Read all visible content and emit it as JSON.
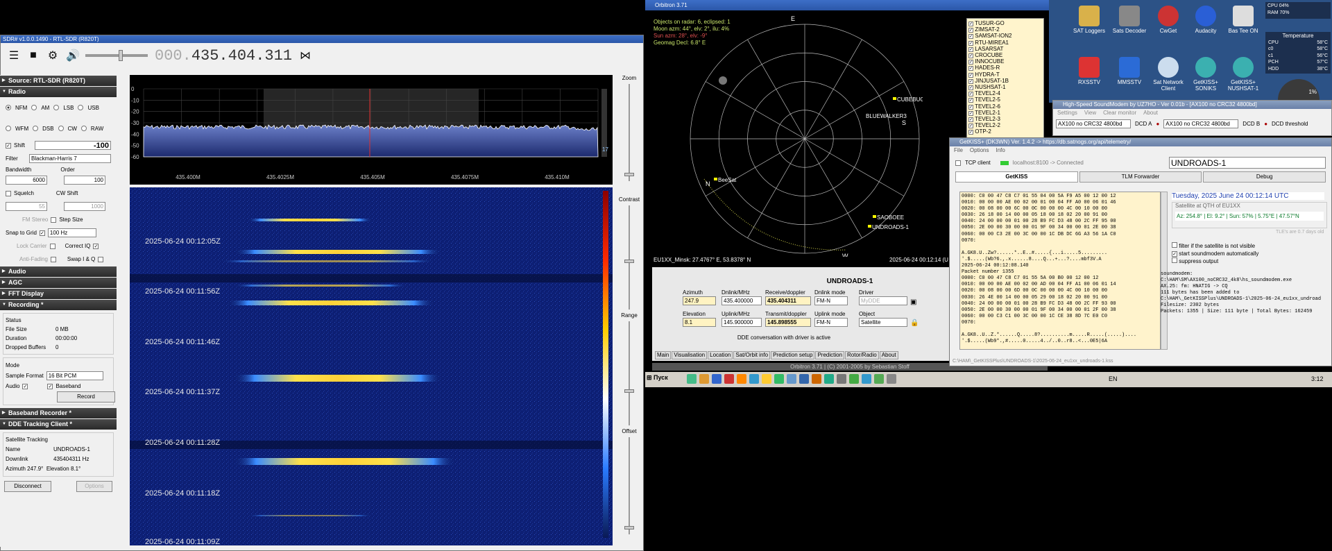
{
  "sdr": {
    "title": "SDR# v1.0.0.1490 - RTL-SDR (R820T)",
    "freq_dim": "000.",
    "freq_main": "435.404.311",
    "sections": {
      "source": "Source: RTL-SDR (R820T)",
      "radio": "Radio",
      "audio": "Audio",
      "agc": "AGC",
      "fft": "FFT Display",
      "recording": "Recording *",
      "baseband": "Baseband Recorder *",
      "dde": "DDE Tracking Client *"
    },
    "modes": [
      "NFM",
      "AM",
      "LSB",
      "USB",
      "WFM",
      "DSB",
      "CW",
      "RAW"
    ],
    "shift_label": "Shift",
    "shift_value": "-100",
    "filter_label": "Filter",
    "filter_value": "Blackman-Harris 7",
    "bandwidth_label": "Bandwidth",
    "bandwidth_value": "6000",
    "order_label": "Order",
    "order_value": "100",
    "squelch": "Squelch",
    "cw_shift": "CW Shift",
    "sq_value": "55",
    "cw_value": "1000",
    "fm_stereo": "FM Stereo",
    "step_size": "Step Size",
    "snap": "Snap to Grid",
    "snap_value": "100 Hz",
    "lock_carrier": "Lock Carrier",
    "correct_iq": "Correct IQ",
    "anti_fading": "Anti-Fading",
    "swap_iq": "Swap I & Q",
    "status": "Status",
    "file_size_l": "File Size",
    "file_size": "0 MB",
    "duration_l": "Duration",
    "duration": "00:00:00",
    "dropped_l": "Dropped Buffers",
    "dropped": "0",
    "mode_l": "Mode",
    "sample_format_l": "Sample Format",
    "sample_format": "16 Bit PCM",
    "audio_chk": "Audio",
    "baseband_chk": "Baseband",
    "record_btn": "Record",
    "sat_tracking": "Satellite Tracking",
    "name_l": "Name",
    "name": "UNDROADS-1",
    "downlink_l": "Downlink",
    "downlink": "435404311 Hz",
    "azimuth_l": "Azimuth",
    "azimuth": "247.9°",
    "elevation_l": "Elevation",
    "elevation": "8.1°",
    "disconnect": "Disconnect",
    "options": "Options",
    "zoom": "Zoom",
    "contrast": "Contrast",
    "range": "Range",
    "offset": "Offset",
    "spectrum_y": [
      "0",
      "-10",
      "-20",
      "-30",
      "-40",
      "-50",
      "-60"
    ],
    "spectrum_x": [
      "435.400M",
      "435.4025M",
      "435.405M",
      "435.4075M",
      "435.410M"
    ],
    "spectrum_side": "17",
    "wf_times": [
      "2025-06-24 00:12:05Z",
      "2025-06-24 00:11:56Z",
      "2025-06-24 00:11:46Z",
      "2025-06-24 00:11:37Z",
      "2025-06-24 00:11:28Z",
      "2025-06-24 00:11:18Z",
      "2025-06-24 00:11:09Z"
    ]
  },
  "orbitron": {
    "title": "Orbitron 3.71",
    "info": [
      "Objects on radar: 6, eclipsed: 1",
      "Moon azm: 44°, elv: 2°, ilu: 4%",
      "Sun azm: 28°, elv: -9°",
      "",
      "Geomag Decl: 6.8° E"
    ],
    "compass": {
      "n": "N",
      "e": "E",
      "s": "S",
      "w": "W"
    },
    "radar_labels": [
      "CUBEBUG-2",
      "BLUEWALKER3",
      "BeeSat",
      "SAOBOEE",
      "UNDROADS-1"
    ],
    "location": "EU1XX_Minsk: 27.4767° E, 53.8378° N",
    "timestamp": "2025-06-24 00:12:14 (U",
    "sats": [
      "TUSUR-GO",
      "ZIMSAT-2",
      "SAMSAT-ION2",
      "RTU-MIREA1",
      "LASARSAT",
      "CROCUBE",
      "INNOCUBE",
      "HADES-R",
      "HYDRA-T",
      "JINJUSAT-1B",
      "NUSHSAT-1",
      "TEVEL2-4",
      "TEVEL2-5",
      "TEVEL2-6",
      "TEVEL2-1",
      "TEVEL2-3",
      "TEVEL2-2",
      "OTP-2"
    ],
    "sat_name": "UNDROADS-1",
    "azimuth_l": "Azimuth",
    "azimuth": "247.9",
    "elevation_l": "Elevation",
    "elevation": "8.1",
    "dnlink_l": "Dnlink/MHz",
    "dnlink": "435.400000",
    "uplink_l": "Uplink/MHz",
    "uplink": "145.900000",
    "rx_l": "Receive/doppler",
    "rx": "435.404311",
    "tx_l": "Transmit/doppler",
    "tx": "145.898555",
    "dnmode_l": "Dnlink mode",
    "dnmode": "FM-N",
    "upmode_l": "Uplink mode",
    "upmode": "FM-N",
    "driver_l": "Driver",
    "driver": "MyDDE",
    "object_l": "Object",
    "object": "Satellite",
    "dde_msg": "DDE conversation with driver is active",
    "tabs": [
      "Main",
      "Visualisation",
      "Location",
      "Sat/Orbit info",
      "Prediction setup",
      "Prediction",
      "Rotor/Radio",
      "About"
    ],
    "footer": "Orbitron 3.71 | (C) 2001-2005 by Sebastian Stoff"
  },
  "desktop": {
    "icons": [
      "SAT Loggers",
      "Sats Decoder",
      "CwGet",
      "Audacity",
      "Bas Tee ON",
      "RXSSTV",
      "MMSSTV",
      "Sat Network Client",
      "GetKISS+ SONIKS",
      "GetKISS+ NUSHSAT-1"
    ],
    "cpu": "CPU",
    "ram": "RAM",
    "cpu_v": "04%",
    "ram_v": "70%",
    "temp_title": "Temperature",
    "temps": [
      [
        "CPU",
        "58°C"
      ],
      [
        "c0",
        "58°C"
      ],
      [
        "c1",
        "56°C"
      ],
      [
        "PCH",
        "57°C"
      ],
      [
        "HDD",
        "38°C"
      ]
    ],
    "gauge": "1%"
  },
  "soundmodem": {
    "title": "High-Speed SoundModem by UZ7HO - Ver 0.01b - [AX100 no CRC32 4800bd]",
    "menu": [
      "Settings",
      "View",
      "Clear monitor",
      "About"
    ],
    "mode_a": "AX100 no CRC32 4800bd",
    "dcd_a": "DCD A",
    "mode_b": "AX100 no CRC32 4800bd",
    "dcd_b": "DCD B",
    "dcd_thr": "DCD threshold"
  },
  "getkiss": {
    "title": "GetKISS+ (DK3WN) Ver. 1.4.2 -> https://db.satnogs.org/api/telemetry/",
    "menu": [
      "File",
      "Options",
      "Info"
    ],
    "tcp": "TCP client",
    "conn": "localhost:8100 -> Connected",
    "sat": "UNDROADS-1",
    "tabs": [
      "GetKISS",
      "TLM Forwarder",
      "Debug"
    ],
    "hex": "0000: C0 00 47 C8 C7 01 55 04 00 5A F9 A5 00 12 00 12\n0010: 00 00 00 AE 00 02 00 01 00 04 FF A0 00 06 01 46\n0020: 00 08 00 00 6C 00 0C 00 00 00 4C 00 10 00 00\n0030: 26 18 00 14 00 00 05 18 00 18 02 20 00 91 00\n0040: 24 00 00 00 01 00 28 B9 FC D3 48 00 2C FF 95 00\n0050: 2E 00 00 30 00 00 01 9F 00 34 00 00 01 2E 00 38\n0060: 00 00 C3 2E 00 3C 00 00 1C DB DC 6G A3 56 1A C0\n0070:\n\nA.GK8.U..Zw?......*..E..#.....{...i.....5.........\n'.$.....(Wb?6.,.x......8....Q...+...?....mbf3V.A\n2025-06-24 00:12:08.140\nPacket number 1355\n0000: C0 00 47 C8 C7 01 55 5A 00 B0 00 12 00 12\n0010: 00 00 00 AE 00 02 00 AD 00 04 FF A1 00 06 01 14\n0020: 00 08 00 00 6D 00 0C 00 00 00 4C 00 10 00 00\n0030: 26 4E 00 14 00 00 05 29 00 18 02 20 00 91 00\n0040: 24 00 00 00 01 00 28 B9 FC D3 48 00 2C FF 93 00\n0050: 2E 00 00 30 00 00 01 9F 00 34 00 00 01 2F 00 38\n0060: 00 00 C3 C1 00 3C 00 00 1C CE 38 8D 7C E0 C0\n0070:\n\nA.GK8..U..Z.*......Q.....8?..........m.....R.....(.....)....\n'.$.....(Wb9*.,#.....0.....4../..0..r8..<...0E5|6A",
    "date": "Tuesday, 2025 June 24 00:12:14 UTC",
    "qth": "Satellite at QTH of EU1XX",
    "qth_val": "Az: 254.8° | El: 9.2° | Sun: 57% | 5.75°E | 47.57°N",
    "tle": "TLE's are 0.7 days old",
    "chk1": "filter if the satellite is not visible",
    "chk2": "start soundmodem automatically",
    "chk3": "suppress output",
    "log": "soundmodem:\nC:\\HAM\\SM\\AX100_noCRC32_4k8\\hs_soundmodem.exe\nAX.25: fm: HNATIG -> CQ\n111 bytes has been added to\nC:\\HAM\\_GetKISSPlus\\UNDROADS-1\\2025-06-24_eu1xx_undroad\nFilesize: 2302 bytes\nPackets: 1355 | Size: 111 byte | Total Bytes: 162459",
    "status": "C:\\HAM\\_GetKISSPlus\\UNDROADS-1\\2025-06-24_eu1xx_undroads-1.kss"
  },
  "taskbar": {
    "start": "Пуск",
    "lang": "EN",
    "clock": "3:12"
  }
}
